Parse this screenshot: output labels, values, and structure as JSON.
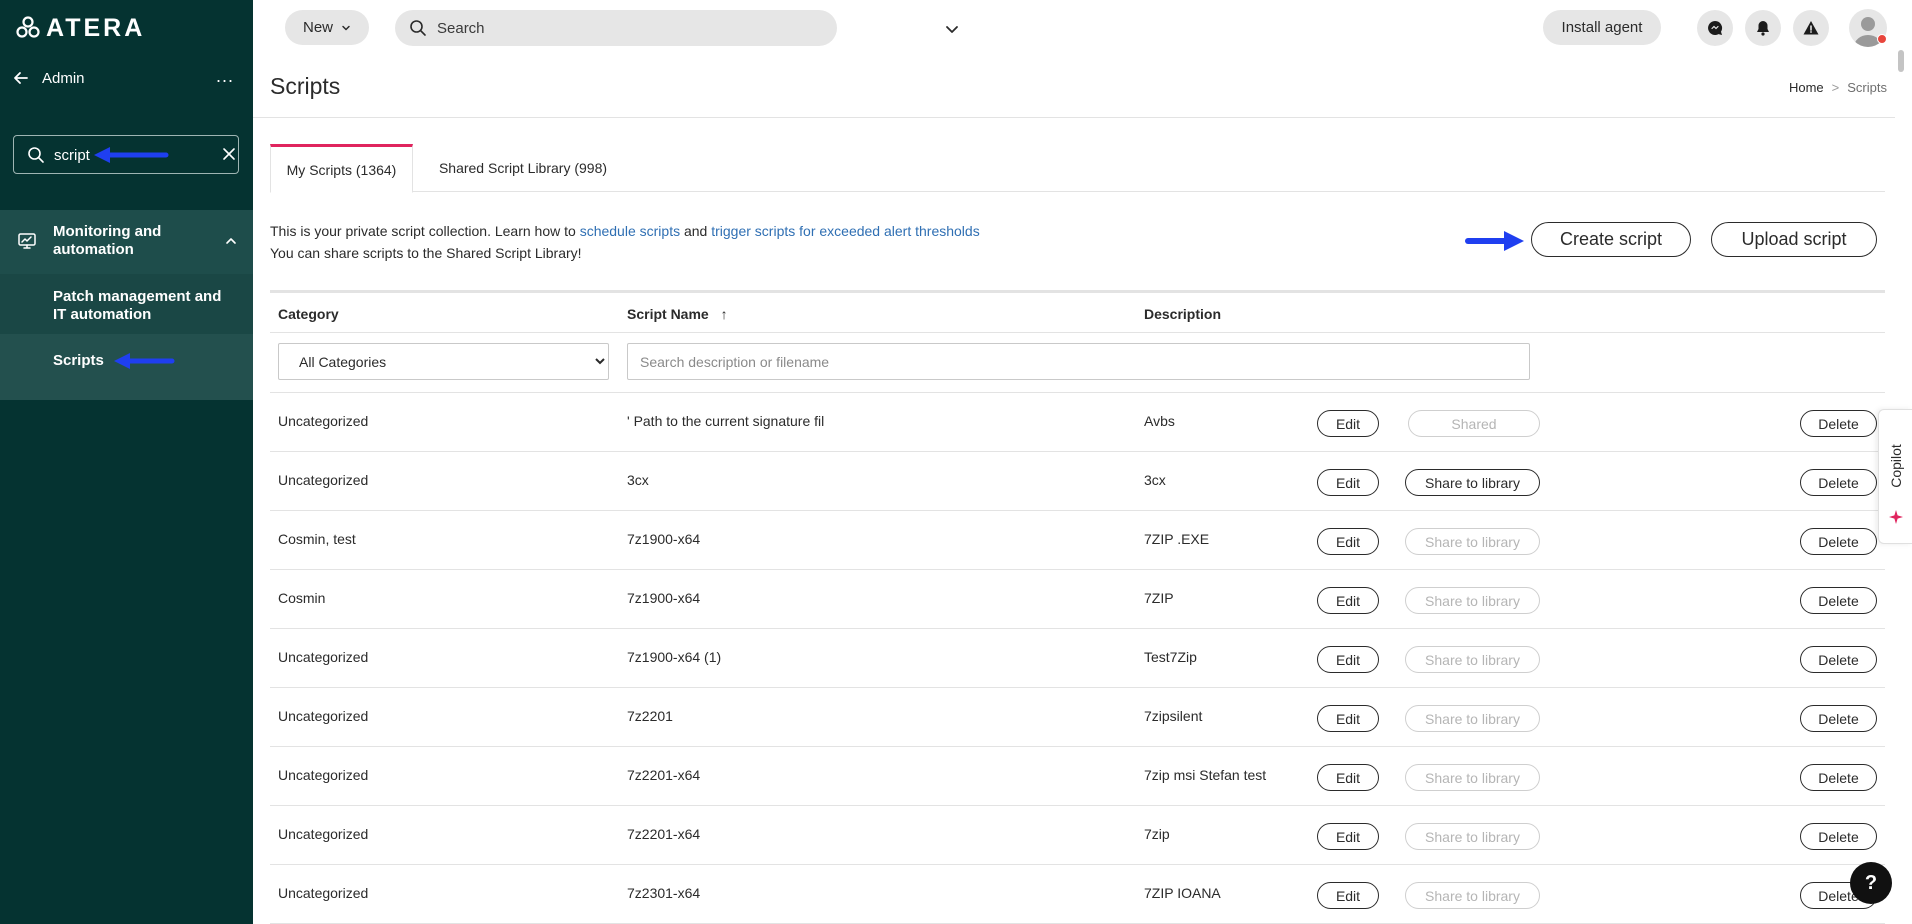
{
  "app": {
    "logo_text": "ATERA"
  },
  "sidebar": {
    "admin_label": "Admin",
    "more_label": "...",
    "search": {
      "value": "script",
      "placeholder": ""
    },
    "group": {
      "label": "Monitoring and automation"
    },
    "sub_items": [
      {
        "label": "Patch management and IT automation"
      },
      {
        "label": "Scripts"
      }
    ]
  },
  "topbar": {
    "new_label": "New",
    "search_placeholder": "Search",
    "install_label": "Install agent"
  },
  "page": {
    "title": "Scripts",
    "breadcrumb": [
      "Home",
      ">",
      "Scripts"
    ]
  },
  "tabs": [
    {
      "label": "My Scripts (1364)"
    },
    {
      "label": "Shared Script Library (998)"
    }
  ],
  "intro": {
    "text1": "This is your private script collection. Learn how to ",
    "link1": "schedule scripts",
    "text2": " and ",
    "link2": "trigger scripts for exceeded alert thresholds",
    "line2": "You can share scripts to the Shared Script Library!"
  },
  "actions": {
    "create_label": "Create script",
    "upload_label": "Upload script"
  },
  "table": {
    "columns": [
      "Category",
      "Script Name",
      "Description"
    ],
    "sort_indicator": "↑",
    "category_filter": "All Categories",
    "search_placeholder": "Search description or filename",
    "row_buttons": {
      "edit": "Edit",
      "delete": "Delete"
    },
    "rows": [
      {
        "category": "Uncategorized",
        "name": "' Path to the current signature fil",
        "description": "Avbs",
        "share_label": "Shared"
      },
      {
        "category": "Uncategorized",
        "name": "3cx",
        "description": "3cx",
        "share_label": "Share to library"
      },
      {
        "category": "Cosmin, test",
        "name": "7z1900-x64",
        "description": "7ZIP .EXE",
        "share_label": "Share to library"
      },
      {
        "category": "Cosmin",
        "name": "7z1900-x64",
        "description": "7ZIP",
        "share_label": "Share to library"
      },
      {
        "category": "Uncategorized",
        "name": "7z1900-x64 (1)",
        "description": "Test7Zip",
        "share_label": "Share to library"
      },
      {
        "category": "Uncategorized",
        "name": "7z2201",
        "description": "7zipsilent",
        "share_label": "Share to library"
      },
      {
        "category": "Uncategorized",
        "name": "7z2201-x64",
        "description": "7zip msi Stefan test",
        "share_label": "Share to library"
      },
      {
        "category": "Uncategorized",
        "name": "7z2201-x64",
        "description": "7zip",
        "share_label": "Share to library"
      },
      {
        "category": "Uncategorized",
        "name": "7z2301-x64",
        "description": "7ZIP IOANA",
        "share_label": "Share to library"
      }
    ]
  },
  "copilot": {
    "label": "Copilot"
  },
  "help": {
    "label": "?"
  },
  "colors": {
    "sidebar": "#053331",
    "accent_tab": "#e0245e",
    "link": "#2f6fb3",
    "annotation_arrow": "#1f3ff0"
  }
}
